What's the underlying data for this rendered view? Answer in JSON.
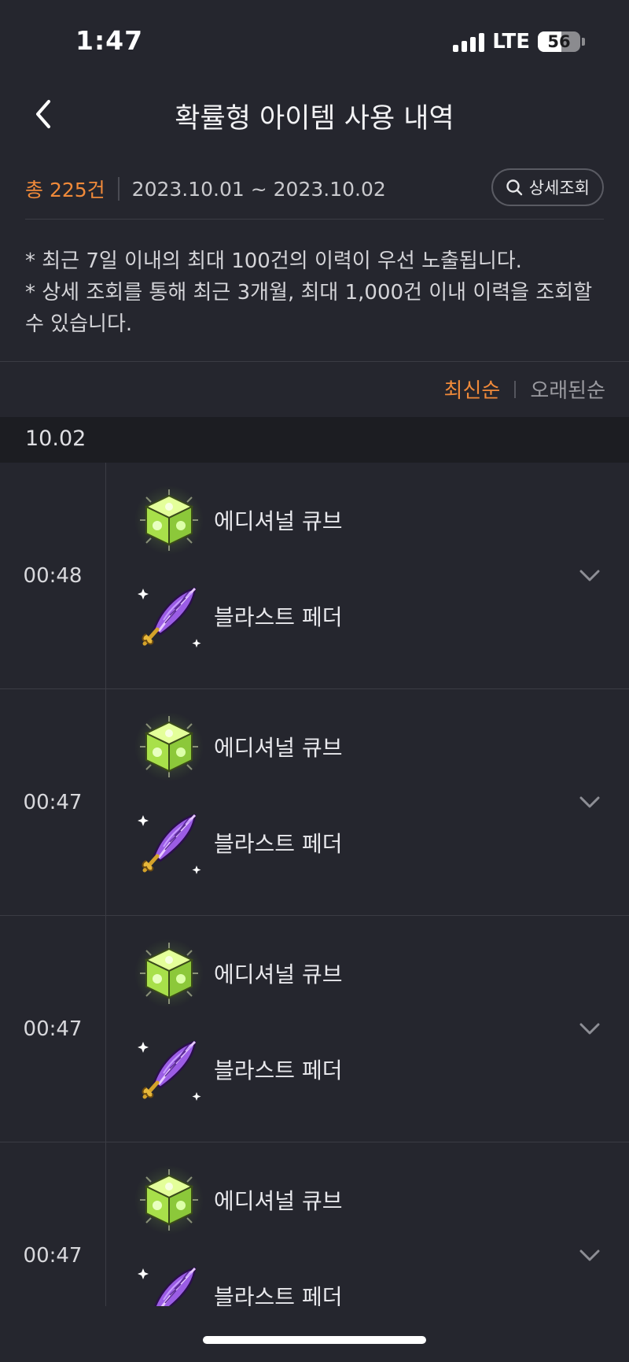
{
  "status_bar": {
    "time": "1:47",
    "network": "LTE",
    "battery": "56",
    "battery_level": 0.56
  },
  "header": {
    "title": "확률형 아이템 사용 내역"
  },
  "summary": {
    "total": "총 225건",
    "date_range": "2023.10.01 ~ 2023.10.02",
    "detail_button": "상세조회"
  },
  "notice": [
    "* 최근 7일 이내의 최대 100건의 이력이 우선 노출됩니다.",
    "* 상세 조회를 통해 최근 3개월, 최대 1,000건 이내 이력을 조회할 수 있습니다."
  ],
  "sort": {
    "newest": "최신순",
    "oldest": "오래된순"
  },
  "date_header": "10.02",
  "entries": [
    {
      "time": "00:48",
      "items": [
        {
          "name": "에디셔널 큐브",
          "icon": "additional-cube-icon"
        },
        {
          "name": "블라스트 페더",
          "icon": "blast-feather-icon"
        }
      ]
    },
    {
      "time": "00:47",
      "items": [
        {
          "name": "에디셔널 큐브",
          "icon": "additional-cube-icon"
        },
        {
          "name": "블라스트 페더",
          "icon": "blast-feather-icon"
        }
      ]
    },
    {
      "time": "00:47",
      "items": [
        {
          "name": "에디셔널 큐브",
          "icon": "additional-cube-icon"
        },
        {
          "name": "블라스트 페더",
          "icon": "blast-feather-icon"
        }
      ]
    },
    {
      "time": "00:47",
      "items": [
        {
          "name": "에디셔널 큐브",
          "icon": "additional-cube-icon"
        },
        {
          "name": "블라스트 페더",
          "icon": "blast-feather-icon"
        }
      ]
    }
  ],
  "colors": {
    "accent": "#f08a3a",
    "background": "#25262e",
    "date_bar": "#1c1d22"
  }
}
